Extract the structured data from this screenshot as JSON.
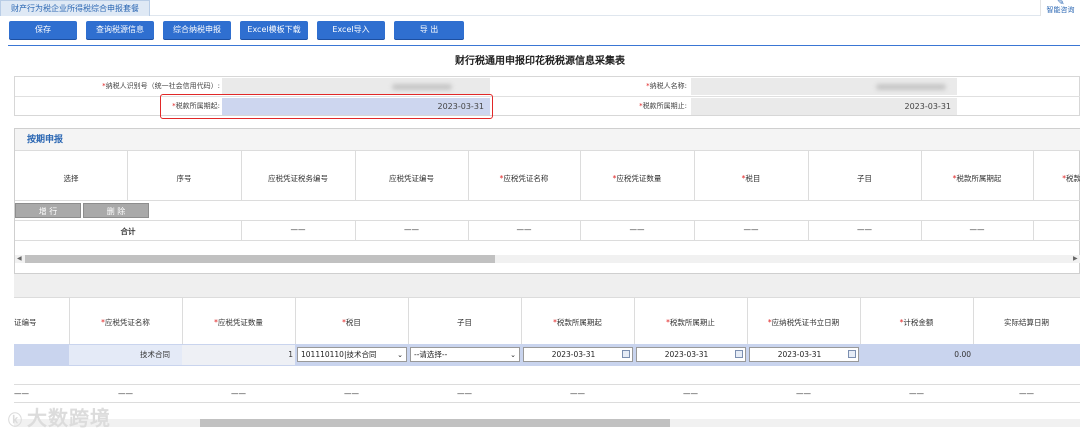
{
  "tab": {
    "title": "财产行为税企业所得税综合申报套餐"
  },
  "assistant": {
    "label": "智能咨询"
  },
  "toolbar": {
    "buttons": [
      "保存",
      "查询税源信息",
      "综合纳税申报",
      "Excel模板下载",
      "Excel导入",
      "导 出"
    ]
  },
  "form_title": "财行税通用申报印花税税源信息采集表",
  "taxpayer": {
    "id_label": "纳税人识别号（统一社会信用代码）:",
    "name_label": "纳税人名称:",
    "period_start_label": "税款所属期起:",
    "period_start": "2023-03-31",
    "period_end_label": "税款所属期止:",
    "period_end": "2023-03-31"
  },
  "section": {
    "title": "按期申报",
    "headers": [
      "选择",
      "序号",
      "应税凭证税务编号",
      "应税凭证编号",
      "应税凭证名称",
      "应税凭证数量",
      "税目",
      "子目",
      "税款所属期起",
      "税款"
    ],
    "required": [
      false,
      false,
      false,
      false,
      true,
      true,
      true,
      false,
      true,
      true
    ],
    "add_row_label": "增 行",
    "delete_label": "删 除",
    "total_label": "合计",
    "dash": "——"
  },
  "detail": {
    "headers": [
      "证编号",
      "应税凭证名称",
      "应税凭证数量",
      "税目",
      "子目",
      "税款所属期起",
      "税款所属期止",
      "应纳税凭证书立日期",
      "计税金额",
      "实际结算日期"
    ],
    "required": [
      false,
      true,
      true,
      true,
      false,
      true,
      true,
      true,
      true,
      false
    ],
    "row": {
      "name": "技术合同",
      "quantity": "1",
      "item": "101110110|技术合同",
      "subitem": "--请选择--",
      "start": "2023-03-31",
      "end": "2023-03-31",
      "sign_date": "2023-03-31",
      "amount": "0.00"
    },
    "dash": "——"
  },
  "watermark": {
    "text": "大数跨境"
  }
}
